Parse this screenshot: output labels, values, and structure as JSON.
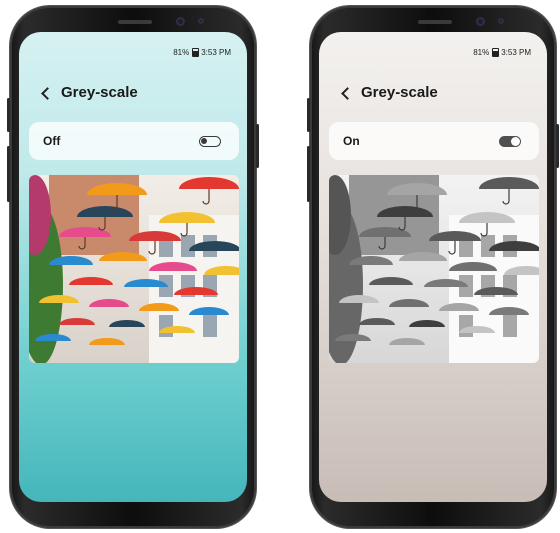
{
  "phones": [
    {
      "status": {
        "battery_percent": "81%",
        "time": "3:53 PM"
      },
      "header": {
        "title": "Grey-scale"
      },
      "setting": {
        "label": "Off",
        "enabled": false
      }
    },
    {
      "status": {
        "battery_percent": "81%",
        "time": "3:53 PM"
      },
      "header": {
        "title": "Grey-scale"
      },
      "setting": {
        "label": "On",
        "enabled": true
      }
    }
  ],
  "photo": {
    "subject": "umbrellas-over-street"
  },
  "colors": {
    "teal_bottom": "#45b6bc",
    "grey_bottom": "#c8bdb6",
    "toggle_on": "#4f4f4f"
  }
}
